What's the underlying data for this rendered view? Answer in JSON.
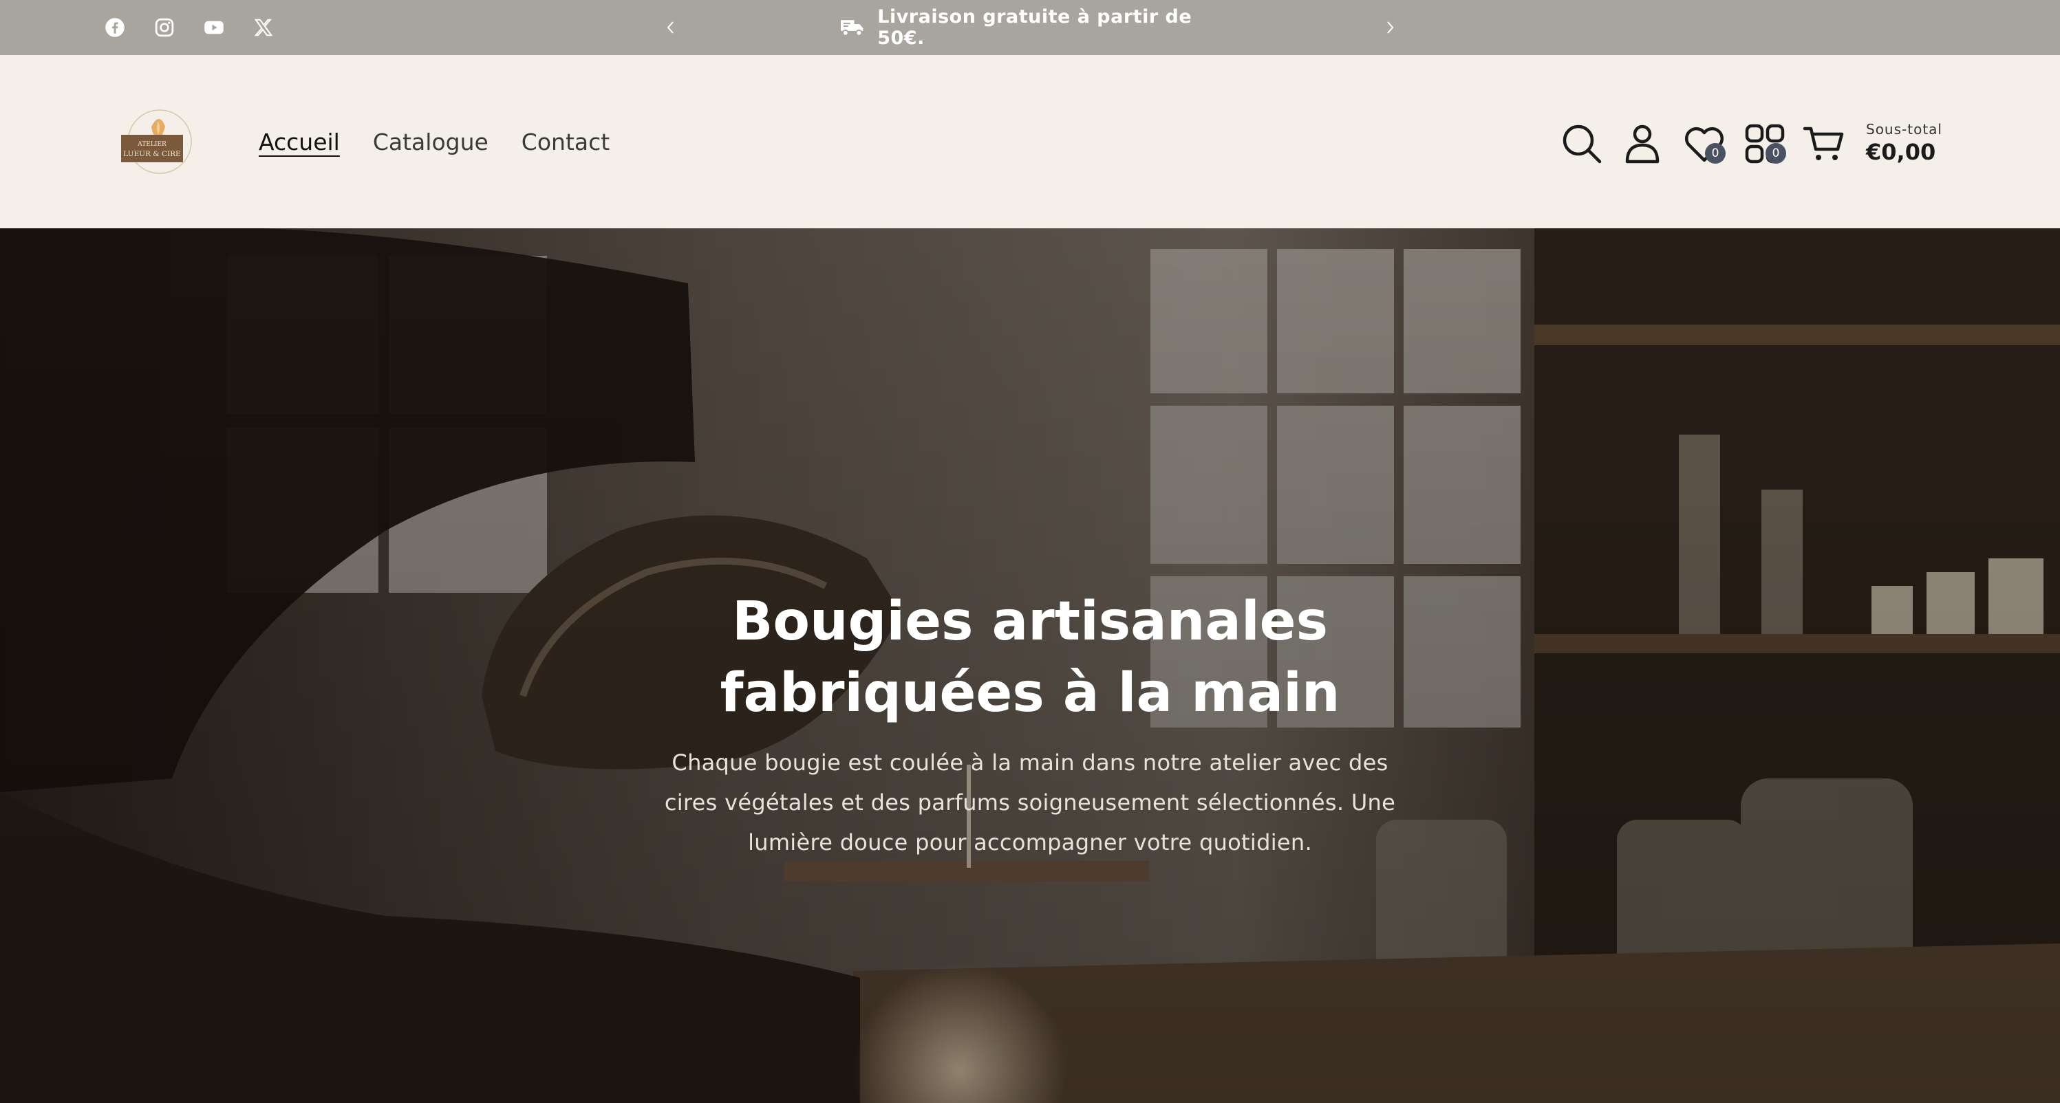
{
  "announcement": {
    "text": "Livraison gratuite à partir de 50€.",
    "icon": "delivery-truck-icon"
  },
  "social": [
    "facebook-icon",
    "instagram-icon",
    "youtube-icon",
    "x-icon"
  ],
  "logo": {
    "line1": "ATELIER",
    "line2": "LUEUR & CIRE"
  },
  "nav": {
    "items": [
      {
        "label": "Accueil",
        "active": true
      },
      {
        "label": "Catalogue",
        "active": false
      },
      {
        "label": "Contact",
        "active": false
      }
    ]
  },
  "header_icons": {
    "wishlist_count": "0",
    "compare_count": "0",
    "subtotal_label": "Sous-total",
    "subtotal_value": "€0,00"
  },
  "hero": {
    "title_line1": "Bougies artisanales",
    "title_line2": "fabriquées à la main",
    "description": "Chaque bougie est coulée à la main dans notre atelier avec des cires végétales et des parfums soigneusement sélectionnés. Une lumière douce pour accompagner votre quotidien."
  },
  "colors": {
    "topbar": "#a8a59e",
    "header": "#f4f0e9",
    "badge": "#4a5160",
    "logo_brown": "#7a5a3a"
  }
}
